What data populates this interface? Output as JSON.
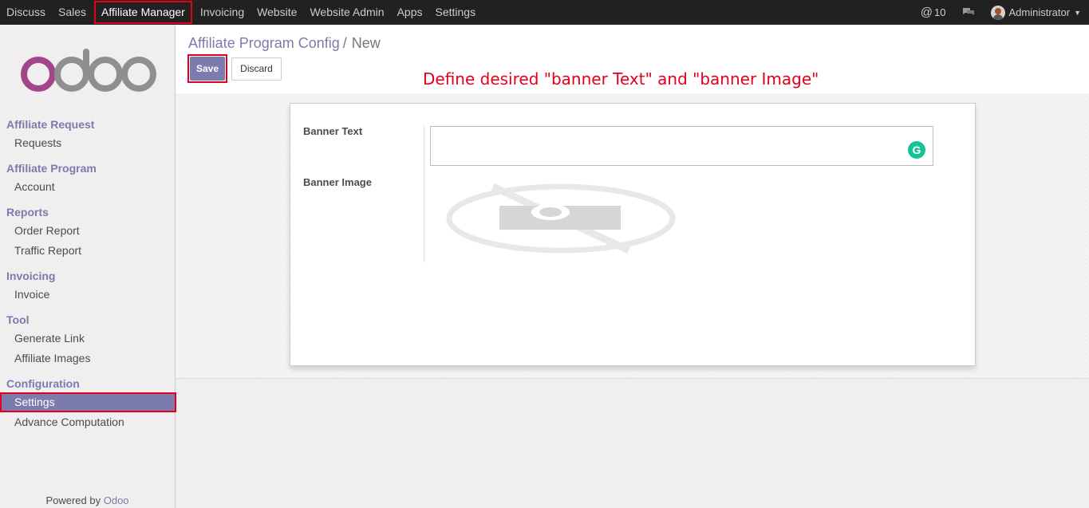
{
  "topbar": {
    "nav": [
      "Discuss",
      "Sales",
      "Affiliate Manager",
      "Invoicing",
      "Website",
      "Website Admin",
      "Apps",
      "Settings"
    ],
    "active": "Affiliate Manager",
    "notifications_count": "10",
    "user": "Administrator"
  },
  "sidebar": {
    "logo_text": "odoo",
    "sections": [
      {
        "title": "Affiliate Request",
        "items": [
          "Requests"
        ]
      },
      {
        "title": "Affiliate Program",
        "items": [
          "Account"
        ]
      },
      {
        "title": "Reports",
        "items": [
          "Order Report",
          "Traffic Report"
        ]
      },
      {
        "title": "Invoicing",
        "items": [
          "Invoice"
        ]
      },
      {
        "title": "Tool",
        "items": [
          "Generate Link",
          "Affiliate Images"
        ]
      },
      {
        "title": "Configuration",
        "items": [
          "Settings",
          "Advance Computation"
        ]
      }
    ],
    "selected": "Settings",
    "powered_by": "Powered by",
    "powered_brand": "Odoo"
  },
  "control_panel": {
    "breadcrumb_parent": "Affiliate Program Config",
    "breadcrumb_sep": "/",
    "breadcrumb_current": "New",
    "save_label": "Save",
    "discard_label": "Discard"
  },
  "annotation": "Define desired \"banner Text\" and \"banner Image\"",
  "form": {
    "banner_text_label": "Banner Text",
    "banner_text_value": "",
    "banner_image_label": "Banner Image",
    "grammarly_icon_letter": "G"
  },
  "colors": {
    "topbar": "#212121",
    "brand": "#7c7bad",
    "highlight": "#e2001a",
    "grammarly": "#15c39a"
  }
}
